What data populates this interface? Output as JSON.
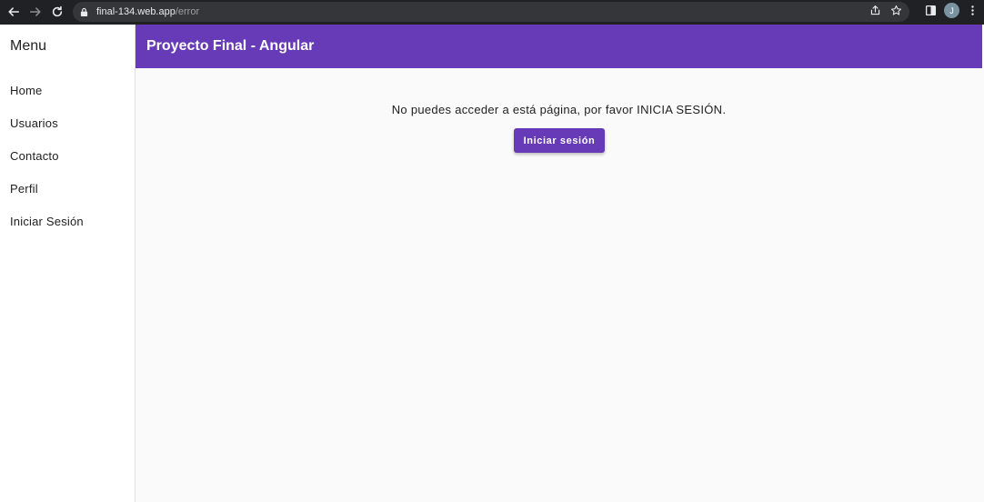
{
  "browser": {
    "url_host": "final-134.web.app",
    "url_path": "/error",
    "avatar_initial": "J"
  },
  "sidebar": {
    "title": "Menu",
    "items": [
      {
        "label": "Home"
      },
      {
        "label": "Usuarios"
      },
      {
        "label": "Contacto"
      },
      {
        "label": "Perfil"
      },
      {
        "label": "Iniciar Sesión"
      }
    ]
  },
  "toolbar": {
    "title": "Proyecto Final - Angular"
  },
  "main": {
    "message": "No puedes acceder a está página, por favor INICIA SESIÓN.",
    "button_label": "Iniciar sesión"
  },
  "colors": {
    "primary": "#673ab7",
    "background": "#fafafa",
    "browser_chrome": "#202124"
  }
}
